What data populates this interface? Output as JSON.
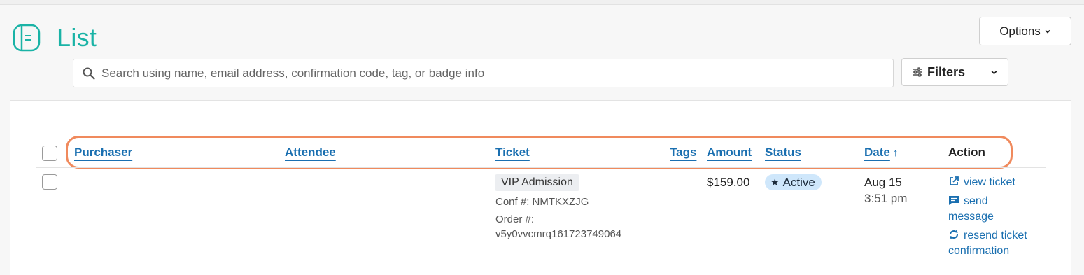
{
  "header": {
    "title": "List",
    "logo_icon": "book-icon",
    "options_label": "Options"
  },
  "search": {
    "placeholder": "Search using name, email address, confirmation code, tag, or badge info",
    "value": ""
  },
  "filters": {
    "label": "Filters"
  },
  "table": {
    "columns": [
      {
        "key": "purchaser",
        "label": "Purchaser",
        "sortable": true
      },
      {
        "key": "attendee",
        "label": "Attendee",
        "sortable": true
      },
      {
        "key": "ticket",
        "label": "Ticket",
        "sortable": true
      },
      {
        "key": "tags",
        "label": "Tags",
        "sortable": true
      },
      {
        "key": "amount",
        "label": "Amount",
        "sortable": true
      },
      {
        "key": "status",
        "label": "Status",
        "sortable": true
      },
      {
        "key": "date",
        "label": "Date",
        "sortable": true,
        "sort": "ascending"
      },
      {
        "key": "action",
        "label": "Action",
        "sortable": false
      }
    ],
    "rows": [
      {
        "purchaser": "",
        "attendee": "",
        "ticket": {
          "type": "VIP Admission",
          "conf_label": "Conf #: NMTKXZJG",
          "order_label": "Order #:",
          "order_number": "v5y0vvcmrq161723749064"
        },
        "tags": "",
        "amount": "$159.00",
        "status": "Active",
        "date": "Aug 15",
        "time": "3:51 pm",
        "actions": {
          "view_ticket": "view ticket",
          "send_line1": "send",
          "send_line2": "message",
          "resend_line1": "resend ticket",
          "resend_line2": "confirmation"
        }
      }
    ]
  },
  "colors": {
    "brand_teal": "#1ab3a6",
    "link_blue": "#1a6fb0",
    "highlight_orange": "#f08a5d",
    "status_active_bg": "#cfe7fb"
  }
}
